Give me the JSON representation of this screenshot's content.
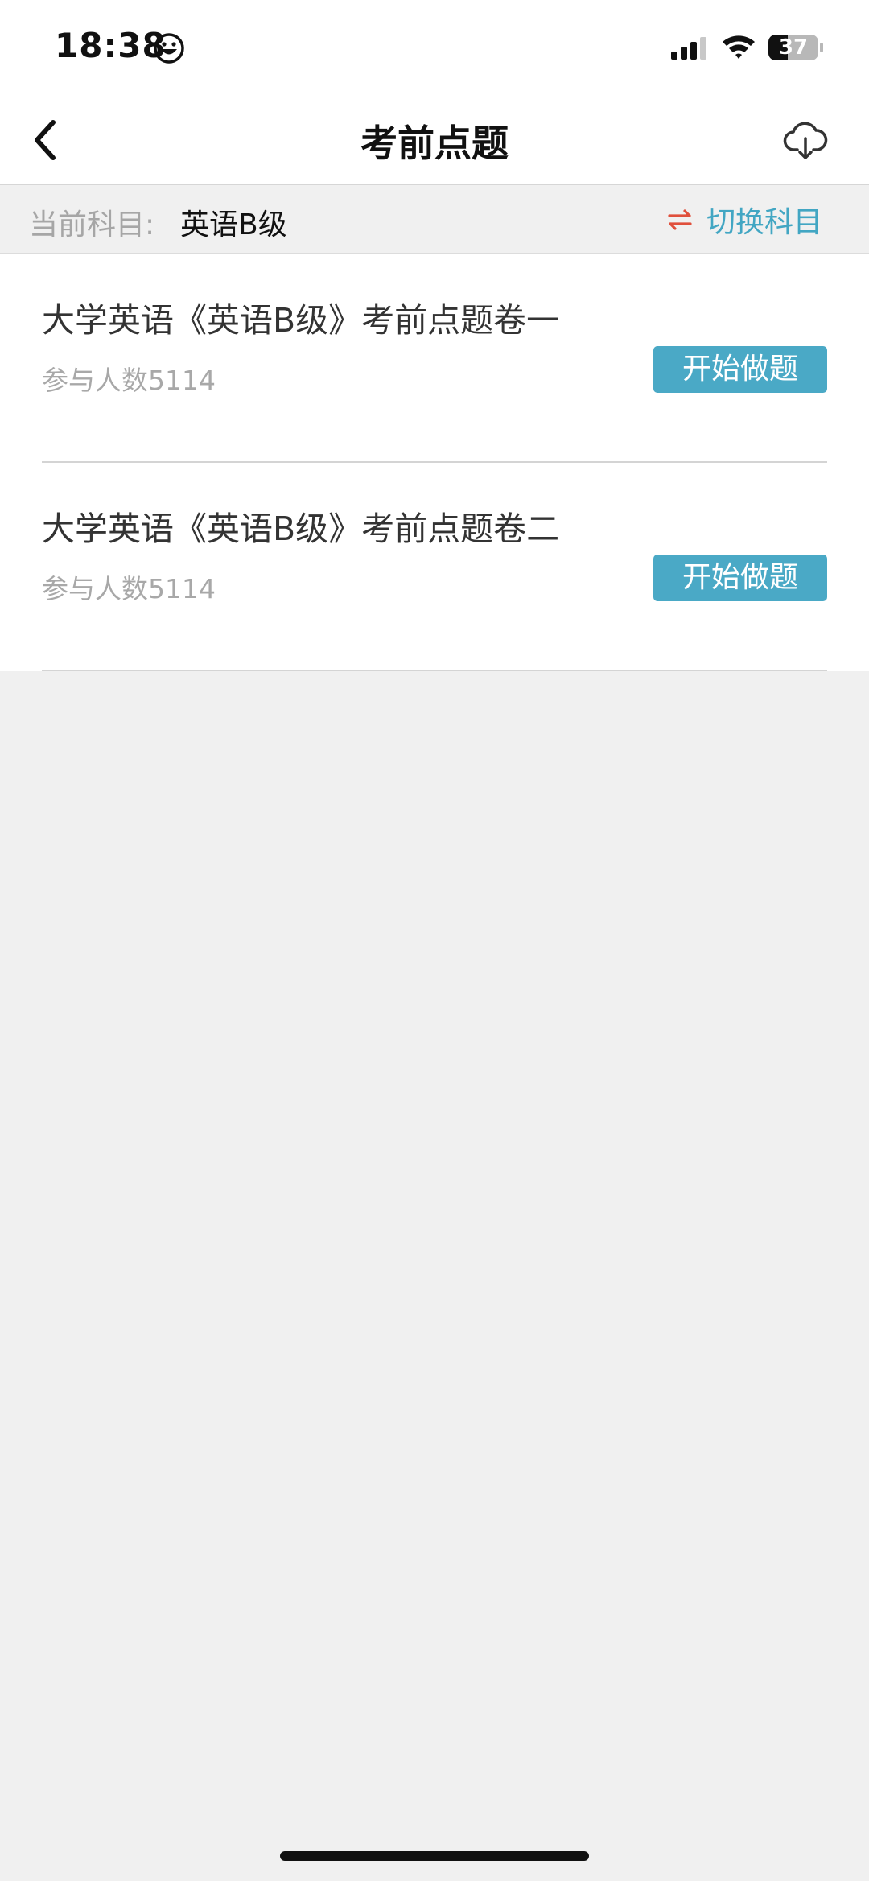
{
  "status_bar": {
    "time": "18:38",
    "battery_level": "37",
    "icons": [
      "smiley-icon",
      "cellular-signal-icon",
      "wifi-icon",
      "battery-icon"
    ]
  },
  "nav": {
    "title": "考前点题",
    "back_icon": "chevron-left-icon",
    "download_icon": "cloud-download-icon"
  },
  "subject": {
    "label": "当前科目:",
    "value": "英语B级",
    "switch_icon": "swap-arrows-icon",
    "switch_label": "切换科目"
  },
  "papers": [
    {
      "title": "大学英语《英语B级》考前点题卷一",
      "participants": "参与人数5114",
      "button_label": "开始做题"
    },
    {
      "title": "大学英语《英语B级》考前点题卷二",
      "participants": "参与人数5114",
      "button_label": "开始做题"
    }
  ],
  "colors": {
    "accent": "#4aa9c6",
    "switch_text": "#42a6c3",
    "switch_icon": "#e0503c",
    "background": "#f0f0f0",
    "muted_text": "#a8a8a8"
  }
}
